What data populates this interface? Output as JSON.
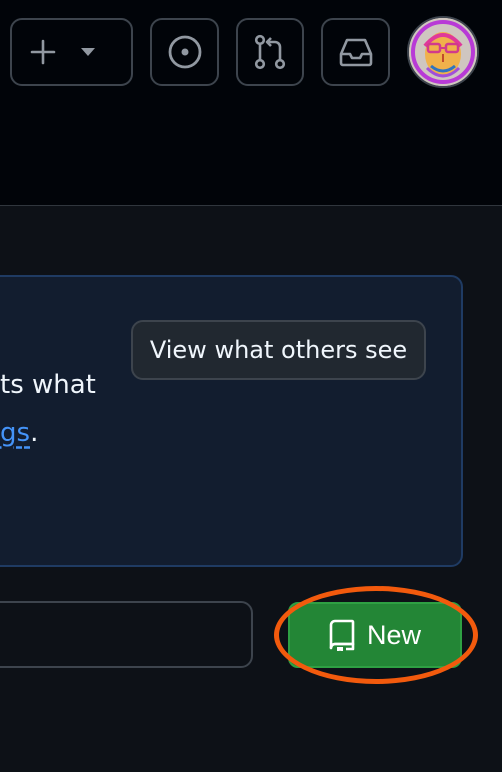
{
  "header": {
    "create_button": {
      "plus_icon": "plus-icon",
      "caret_icon": "triangle-down-icon"
    },
    "issues_button": {
      "icon": "issue-opened-icon"
    },
    "pulls_button": {
      "icon": "git-pull-request-icon"
    },
    "inbox_button": {
      "icon": "inbox-icon"
    },
    "avatar": {
      "icon": "user-avatar"
    }
  },
  "notice": {
    "view_button_label": "View what others see",
    "line1_fragment": "ts what",
    "link_fragment": "gs",
    "line2_suffix": "."
  },
  "repo_tools": {
    "find_input_value": "",
    "new_button_label": "New",
    "new_button_icon": "repo-icon"
  },
  "colors": {
    "header_bg": "#010409",
    "page_bg": "#0d1117",
    "notice_bg": "#121d2f",
    "notice_border": "#1f3b63",
    "link": "#4493f8",
    "primary_button": "#238636",
    "highlight": "#f25a0d"
  }
}
